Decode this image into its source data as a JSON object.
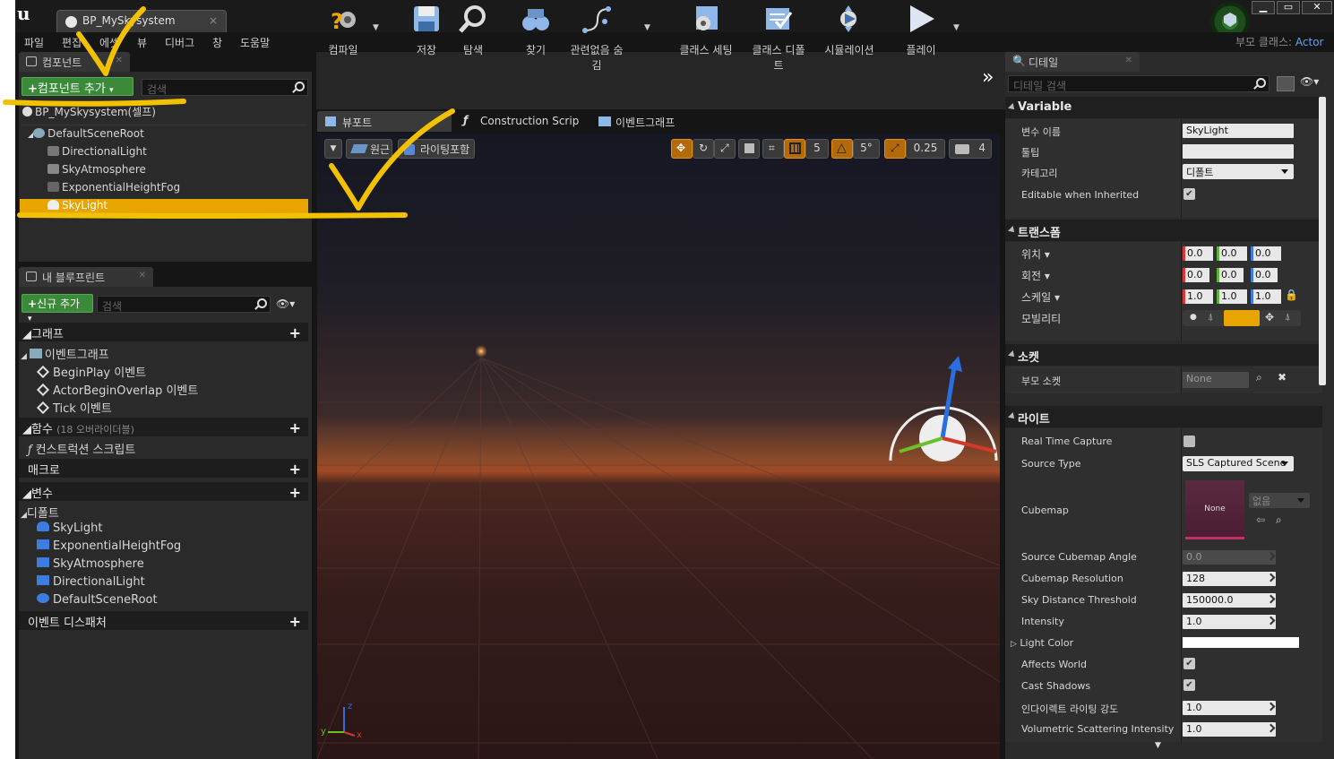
{
  "window": {
    "tab": "BP_MySkysystem",
    "min": "▁",
    "max": "▭",
    "close": "✕",
    "parent_class_label": "부모 클래스:",
    "parent_class_value": "Actor"
  },
  "menu": [
    "파일",
    "편집",
    "에셋",
    "뷰",
    "디버그",
    "창",
    "도움말"
  ],
  "components": {
    "tab": "컴포넌트",
    "add_label": "컴포넌트 추가",
    "search_placeholder": "검색",
    "self_label": "BP_MySkysystem(셀프)",
    "tree": [
      "DefaultSceneRoot",
      "DirectionalLight",
      "SkyAtmosphere",
      "ExponentialHeightFog",
      "SkyLight"
    ],
    "selected": "SkyLight"
  },
  "myblueprint": {
    "tab": "내 블루프린트",
    "add_label": "신규 추가",
    "search_placeholder": "검색",
    "graph_header": "그래프",
    "event_graph": "이벤트그래프",
    "events": [
      "BeginPlay 이벤트",
      "ActorBeginOverlap 이벤트",
      "Tick 이벤트"
    ],
    "functions_header": "함수",
    "functions_note": "(18 오버라이더블)",
    "construction": "컨스트럭션 스크립트",
    "macros_header": "매크로",
    "variables_header": "변수",
    "components_header": "디폴트",
    "variables": [
      "SkyLight",
      "ExponentialHeightFog",
      "SkyAtmosphere",
      "DirectionalLight",
      "DefaultSceneRoot"
    ],
    "dispatchers_header": "이벤트 디스패처"
  },
  "toolbar": {
    "items": [
      "컴파일",
      "저장",
      "탐색",
      "찾기",
      "관련없음 숨김",
      "클래스 세팅",
      "클래스 디폴트",
      "시뮬레이션",
      "플레이"
    ],
    "overflow": "»"
  },
  "viewport_tabs": [
    "뷰포트",
    "Construction Scrip",
    "이벤트그래프"
  ],
  "viewport": {
    "view_mode": "원근",
    "lighting": "라이팅포함",
    "grid_snap": "5",
    "rot_snap": "5°",
    "scale_snap": "0.25",
    "cam_speed": "4",
    "axis_z": "z",
    "axis_y": "y",
    "axis_x": "x"
  },
  "details": {
    "tab": "디테일",
    "search_placeholder": "디테일 검색",
    "variable": {
      "title": "Variable",
      "name_label": "변수 이름",
      "name_value": "SkyLight",
      "tooltip_label": "툴팁",
      "tooltip_value": "",
      "category_label": "카테고리",
      "category_value": "디폴트",
      "editable_label": "Editable when Inherited",
      "editable": true
    },
    "transform": {
      "title": "트랜스폼",
      "location_label": "위치",
      "rotation_label": "회전",
      "scale_label": "스케일",
      "mobility_label": "모빌리티",
      "location": [
        "0.0",
        "0.0",
        "0.0"
      ],
      "rotation": [
        "0.0",
        "0.0",
        "0.0"
      ],
      "scale": [
        "1.0",
        "1.0",
        "1.0"
      ]
    },
    "sockets": {
      "title": "소켓",
      "parent_label": "부모 소켓",
      "parent_value": "None"
    },
    "light": {
      "title": "라이트",
      "real_time_label": "Real Time Capture",
      "real_time": false,
      "source_type_label": "Source Type",
      "source_type_value": "SLS Captured Scene",
      "cubemap_label": "Cubemap",
      "cubemap_value": "None",
      "cubemap_dropdown": "없음",
      "angle_label": "Source Cubemap Angle",
      "angle_value": "0.0",
      "resolution_label": "Cubemap Resolution",
      "resolution_value": "128",
      "sky_dist_label": "Sky Distance Threshold",
      "sky_dist_value": "150000.0",
      "intensity_label": "Intensity",
      "intensity_value": "1.0",
      "color_label": "Light Color",
      "color_value": "#ffffff",
      "affects_label": "Affects World",
      "affects": true,
      "shadows_label": "Cast Shadows",
      "shadows": true,
      "indirect_label": "인다이렉트 라이팅 강도",
      "indirect_value": "1.0",
      "volumetric_label": "Volumetric Scattering Intensity",
      "volumetric_value": "1.0"
    }
  },
  "colors": {
    "accent": "#e8a500",
    "annotation": "#f2c200",
    "green_button": "#3a8a3a"
  }
}
